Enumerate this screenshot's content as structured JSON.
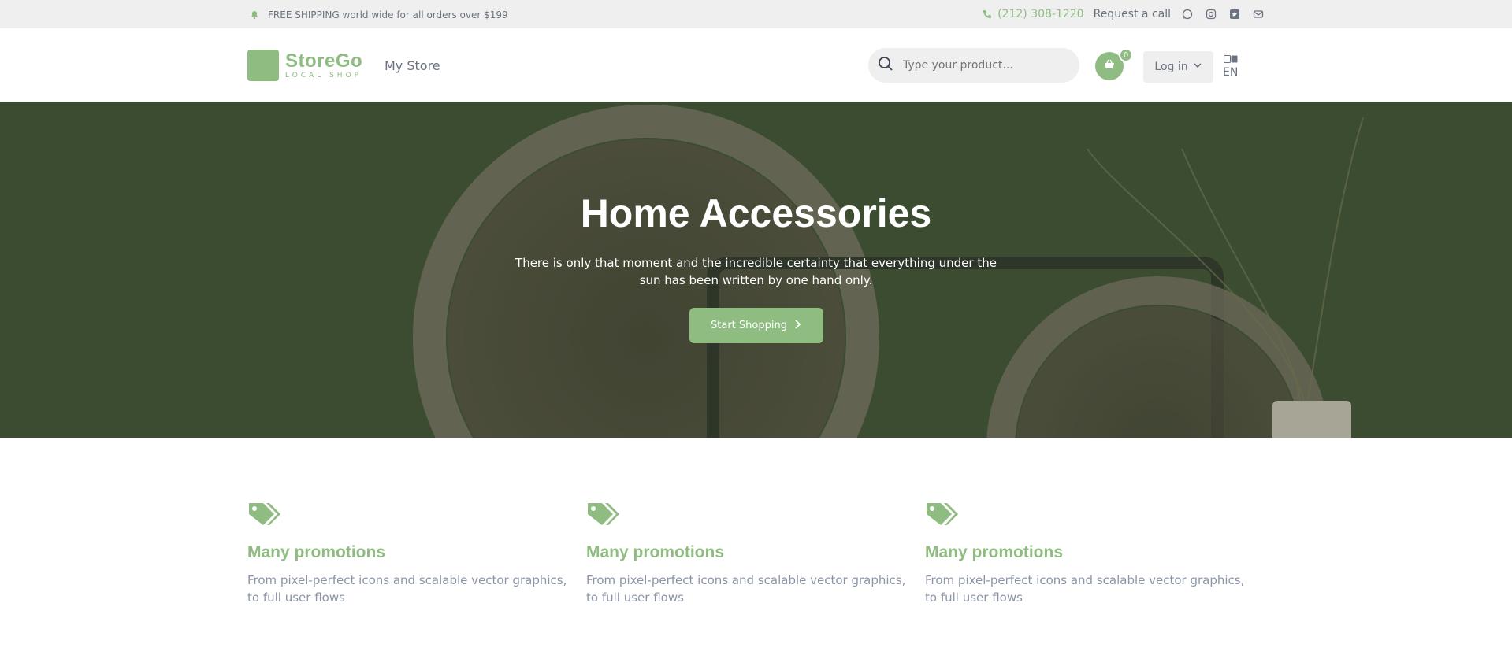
{
  "topbar": {
    "shipping_text": "FREE SHIPPING world wide for all orders over $199",
    "phone": "(212) 308-1220",
    "request_call": "Request a call",
    "icons": [
      "bell-icon",
      "phone-icon",
      "whatsapp-icon",
      "instagram-icon",
      "twitter-icon",
      "mail-icon"
    ]
  },
  "header": {
    "logo_title": "StoreGo",
    "logo_subtitle": "LOCAL SHOP",
    "nav_label": "My Store",
    "search_placeholder": "Type your product...",
    "cart_count": "0",
    "login_label": "Log in",
    "language": "EN"
  },
  "hero": {
    "title": "Home Accessories",
    "text": "There is only that moment and the incredible certainty that everything under the sun has been written by one hand only.",
    "button_label": "Start Shopping"
  },
  "features": [
    {
      "title": "Many promotions",
      "text": "From pixel-perfect icons and scalable vector graphics, to full user flows"
    },
    {
      "title": "Many promotions",
      "text": "From pixel-perfect icons and scalable vector graphics, to full user flows"
    },
    {
      "title": "Many promotions",
      "text": "From pixel-perfect icons and scalable vector graphics, to full user flows"
    }
  ],
  "colors": {
    "accent": "#8fbc80",
    "hero_bg": "#3f5134",
    "topbar_bg": "#efefef",
    "text": "#6b7280"
  }
}
